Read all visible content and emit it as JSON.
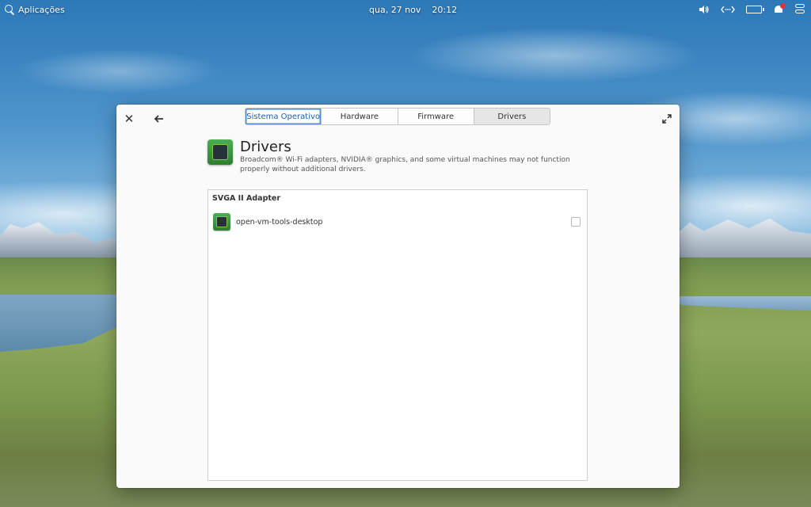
{
  "panel": {
    "apps_label": "Aplicações",
    "date": "qua, 27 nov",
    "time": "20:12",
    "indicators": {
      "sound_icon": "speaker-icon",
      "network_icon": "network-icon",
      "battery_icon": "battery-icon",
      "notifications_icon": "bell-icon",
      "session_icon": "toggles-icon"
    },
    "battery_color": "#7ed321"
  },
  "window": {
    "tabs": [
      {
        "label": "Sistema Operativo"
      },
      {
        "label": "Hardware"
      },
      {
        "label": "Firmware"
      },
      {
        "label": "Drivers"
      }
    ],
    "header": {
      "title": "Drivers",
      "description": "Broadcom® Wi-Fi adapters, NVIDIA® graphics, and some virtual machines may not function properly without additional drivers."
    },
    "list": {
      "heading": "SVGA II Adapter",
      "items": [
        {
          "label": "open-vm-tools-desktop",
          "checked": false
        }
      ]
    }
  }
}
